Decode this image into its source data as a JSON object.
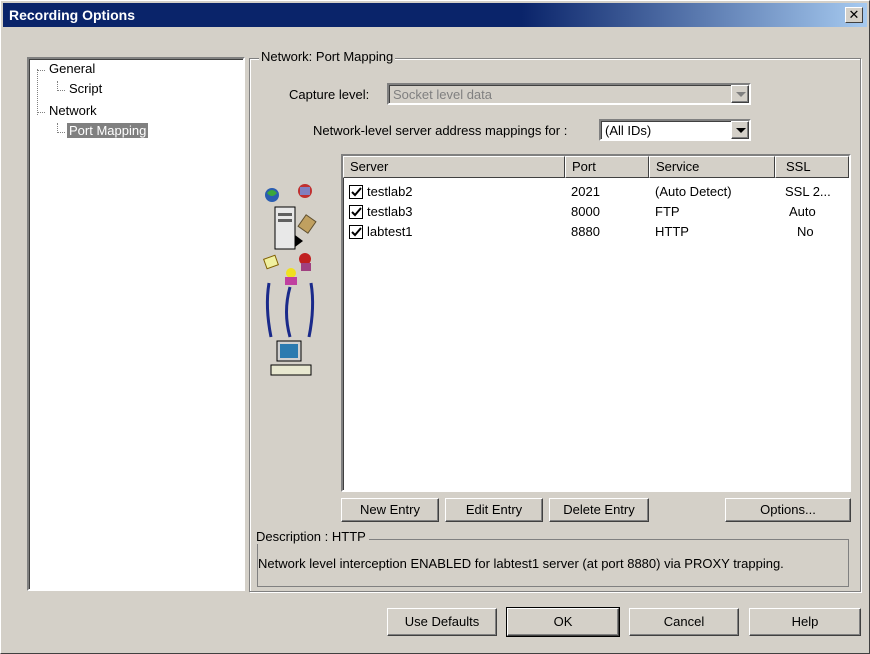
{
  "window": {
    "title": "Recording Options",
    "close_label": "✕"
  },
  "tree": {
    "items": [
      {
        "label": "General"
      },
      {
        "label": "Script"
      },
      {
        "label": "Network"
      },
      {
        "label": "Port Mapping"
      }
    ]
  },
  "group": {
    "title": "Network: Port Mapping",
    "capture_level_label": "Capture level:",
    "capture_level_value": "Socket level data",
    "mappings_label": "Network-level server address mappings for :",
    "mappings_value": "(All IDs)"
  },
  "table": {
    "columns": [
      "Server",
      "Port",
      "Service",
      "SSL"
    ],
    "rows": [
      {
        "checked": true,
        "server": "testlab2",
        "port": "2021",
        "service": "(Auto Detect)",
        "ssl": "SSL 2..."
      },
      {
        "checked": true,
        "server": "testlab3",
        "port": "8000",
        "service": "FTP",
        "ssl": "Auto"
      },
      {
        "checked": true,
        "server": "labtest1",
        "port": "8880",
        "service": "HTTP",
        "ssl": "No"
      }
    ]
  },
  "buttons": {
    "new_entry": "New Entry",
    "edit_entry": "Edit Entry",
    "delete_entry": "Delete Entry",
    "options": "Options...",
    "use_defaults": "Use Defaults",
    "ok": "OK",
    "cancel": "Cancel",
    "help": "Help"
  },
  "description": {
    "title": "Description : HTTP",
    "text": "Network level interception ENABLED for labtest1 server (at port 8880) via PROXY trapping."
  },
  "colors": {
    "title_bar": "#0a246a",
    "face": "#d4d0c8",
    "selection": "#808080"
  }
}
